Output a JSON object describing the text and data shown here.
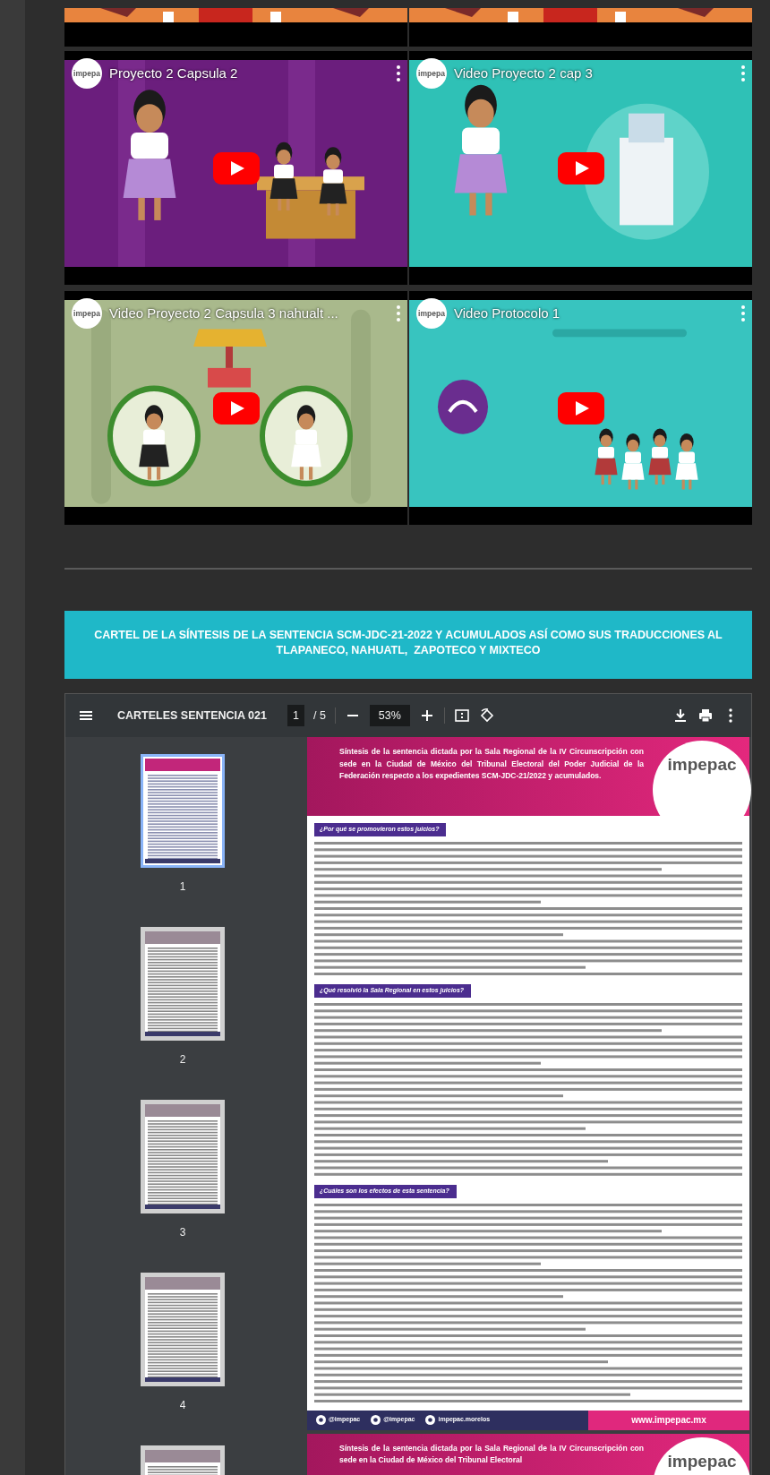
{
  "videos": [
    {
      "title": "Proyecto 2 Capsula 2",
      "channel_logo": "impepa"
    },
    {
      "title": "Video Proyecto 2 cap 3",
      "channel_logo": "impepa"
    },
    {
      "title": "Video Proyecto 2 Capsula 3 nahualt ...",
      "channel_logo": "impepa"
    },
    {
      "title": "Video Protocolo 1",
      "channel_logo": "impepa"
    }
  ],
  "banner": {
    "text": "CARTEL DE LA SÍNTESIS DE LA SENTENCIA SCM-JDC-21-2022 Y ACUMULADOS ASÍ COMO SUS TRADUCCIONES AL TLAPANECO, NAHUATL,  ZAPOTECO Y MIXTECO"
  },
  "pdf_viewer": {
    "title": "CARTELES SENTENCIA 021",
    "page": "1",
    "page_count": "/ 5",
    "zoom": "53%",
    "thumbnails": [
      {
        "label": "1",
        "selected": true
      },
      {
        "label": "2",
        "selected": false
      },
      {
        "label": "3",
        "selected": false
      },
      {
        "label": "4",
        "selected": false
      },
      {
        "selected": false
      }
    ],
    "pages": [
      {
        "header_title": "Síntesis de la sentencia dictada por la Sala Regional de la IV Circunscripción con sede en la Ciudad de México del Tribunal Electoral del Poder Judicial de la Federación respecto a los expedientes SCM-JDC-21/2022 y acumulados.",
        "logo": "impepac",
        "sections": [
          {
            "heading": "¿Por qué se promovieron estos juicios?"
          },
          {
            "heading": "¿Qué resolvió la Sala Regional en estos juicios?"
          },
          {
            "heading": "¿Cuáles son los efectos de esta sentencia?"
          }
        ],
        "footer": {
          "socials": [
            "@impepac",
            "@impepac",
            "impepac.morelos"
          ],
          "url": "www.impepac.mx"
        }
      },
      {
        "header_title": "Síntesis de la sentencia dictada por la Sala Regional de la IV Circunscripción con sede en la Ciudad de México del Tribunal Electoral",
        "logo": "impepac"
      }
    ]
  }
}
